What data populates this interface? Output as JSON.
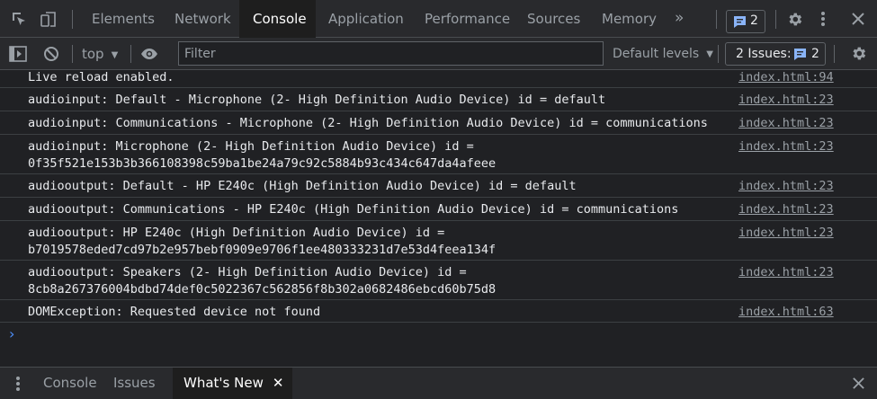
{
  "tabs": [
    {
      "label": "Elements"
    },
    {
      "label": "Network"
    },
    {
      "label": "Console"
    },
    {
      "label": "Application"
    },
    {
      "label": "Performance"
    },
    {
      "label": "Sources"
    },
    {
      "label": "Memory"
    }
  ],
  "more_tabs_glyph": "»",
  "messages_count": "2",
  "toolbar": {
    "context": "top",
    "filter_placeholder": "Filter",
    "levels": "Default levels",
    "issues_label": "2 Issues:",
    "issues_count": "2"
  },
  "logs": [
    {
      "message": "Live reload enabled.",
      "source": "index.html:94"
    },
    {
      "message": "audioinput: Default - Microphone (2- High Definition Audio Device) id = default",
      "source": "index.html:23"
    },
    {
      "message": "audioinput: Communications - Microphone (2- High Definition Audio Device) id = communications",
      "source": "index.html:23"
    },
    {
      "message": "audioinput: Microphone (2- High Definition Audio Device) id =",
      "message2": "0f35f521e153b3b366108398c59ba1be24a79c92c5884b93c434c647da4afeee",
      "source": "index.html:23"
    },
    {
      "message": "audiooutput: Default - HP E240c (High Definition Audio Device) id = default",
      "source": "index.html:23"
    },
    {
      "message": "audiooutput: Communications - HP E240c (High Definition Audio Device) id = communications",
      "source": "index.html:23"
    },
    {
      "message": "audiooutput: HP E240c (High Definition Audio Device) id =",
      "message2": "b7019578eded7cd97b2e957bebf0909e9706f1ee480333231d7e53d4feea134f",
      "source": "index.html:23"
    },
    {
      "message": "audiooutput: Speakers (2- High Definition Audio Device) id =",
      "message2": "8cb8a267376004bdbd74def0c5022367c562856f8b302a0682486ebcd60b75d8",
      "source": "index.html:23"
    },
    {
      "message": "DOMException: Requested device not found",
      "source": "index.html:63"
    }
  ],
  "prompt_glyph": "›",
  "drawer": {
    "tabs": [
      {
        "label": "Console"
      },
      {
        "label": "Issues"
      },
      {
        "label": "What's New"
      }
    ],
    "close_glyph": "✕"
  },
  "colors": {
    "background": "#202124",
    "toolbar": "#292a2d",
    "accent": "#8ab4f8",
    "text": "#e8eaed",
    "muted": "#9aa0a6"
  }
}
